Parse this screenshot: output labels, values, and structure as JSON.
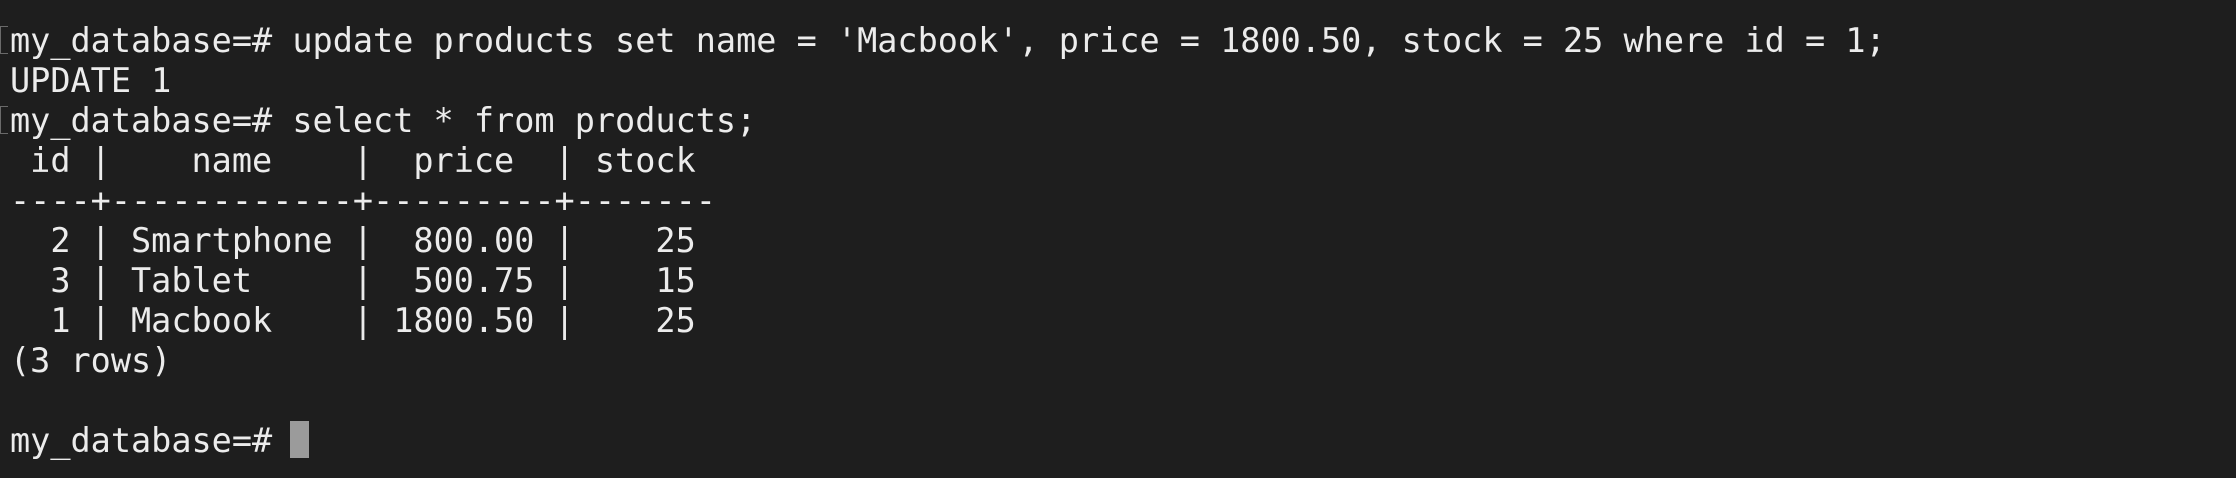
{
  "terminal": {
    "lines": [
      "my_database=# update products set name = 'Macbook', price = 1800.50, stock = 25 where id = 1;",
      "UPDATE 1",
      "my_database=# select * from products;",
      " id |    name    |  price  | stock",
      "----+------------+---------+-------",
      "  2 | Smartphone |  800.00 |    25",
      "  3 | Tablet     |  500.75 |    15",
      "  1 | Macbook    | 1800.50 |    25",
      "(3 rows)",
      "",
      "my_database=# "
    ],
    "colors": {
      "background": "#1e1e1e",
      "text": "#ececec",
      "cursor": "#9b9b9b"
    }
  }
}
